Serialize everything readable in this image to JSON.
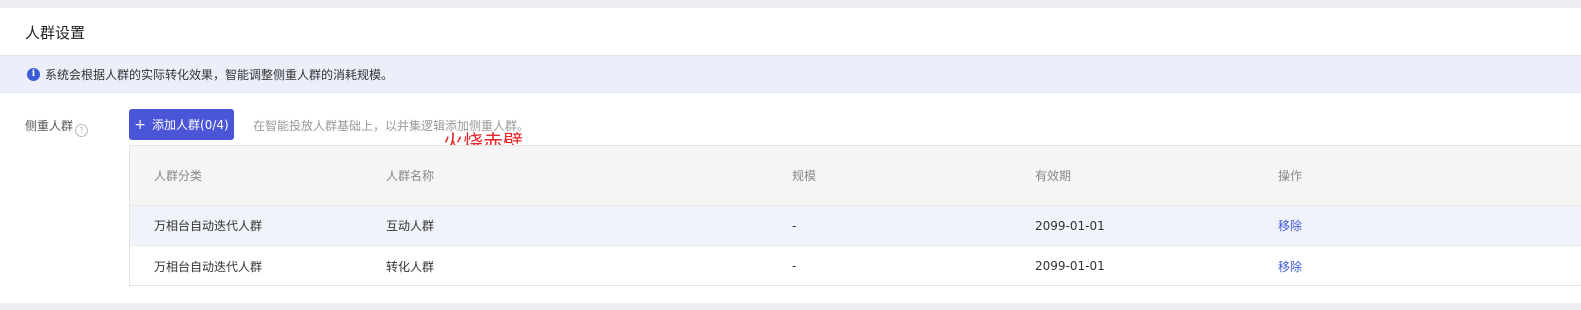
{
  "panel": {
    "title": "人群设置"
  },
  "notice": {
    "icon": "info-icon",
    "text": "系统会根据人群的实际转化效果，智能调整侧重人群的消耗规模。"
  },
  "focus_crowd": {
    "label": "侧重人群",
    "help_symbol": "?",
    "add_button": {
      "symbol": "+",
      "label": "添加人群(0/4)"
    },
    "hint": "在智能投放人群基础上，以并集逻辑添加侧重人群。",
    "watermark": "火烧赤壁"
  },
  "table": {
    "columns": [
      "人群分类",
      "人群名称",
      "规模",
      "有效期",
      "操作"
    ],
    "rows": [
      {
        "category": "万相台自动迭代人群",
        "name": "互动人群",
        "scale": "-",
        "valid_until": "2099-01-01",
        "action": "移除"
      },
      {
        "category": "万相台自动迭代人群",
        "name": "转化人群",
        "scale": "-",
        "valid_until": "2099-01-01",
        "action": "移除"
      }
    ]
  },
  "colors": {
    "accent": "#4a55d8",
    "link": "#3e5bd6",
    "notice_bg": "#eceffa",
    "watermark": "#e8262a"
  }
}
